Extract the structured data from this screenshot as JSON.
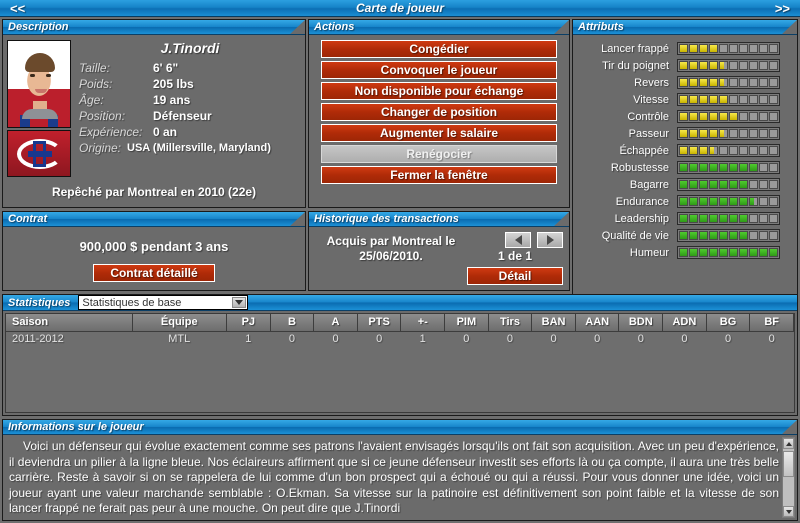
{
  "titlebar": {
    "prev": "<<",
    "title": "Carte de joueur",
    "next": ">>"
  },
  "description": {
    "header": "Description",
    "player_name": "J.Tinordi",
    "fields": [
      {
        "label": "Taille:",
        "value": "6' 6\""
      },
      {
        "label": "Poids:",
        "value": "205 lbs"
      },
      {
        "label": "Âge:",
        "value": "19 ans"
      },
      {
        "label": "Position:",
        "value": "Défenseur"
      },
      {
        "label": "Expérience:",
        "value": "0 an"
      }
    ],
    "origin_label": "Origine:",
    "origin_value": "USA (Millersville, Maryland)",
    "draft_text": "Repêché par Montreal en 2010 (22e)"
  },
  "actions": {
    "header": "Actions",
    "buttons": [
      {
        "label": "Congédier",
        "disabled": false
      },
      {
        "label": "Convoquer le joueur",
        "disabled": false
      },
      {
        "label": "Non disponible pour échange",
        "disabled": false
      },
      {
        "label": "Changer de position",
        "disabled": false
      },
      {
        "label": "Augmenter le salaire",
        "disabled": false
      },
      {
        "label": "Renégocier",
        "disabled": true
      },
      {
        "label": "Fermer la fenêtre",
        "disabled": false
      }
    ]
  },
  "attributs": {
    "header": "Attributs",
    "max": 10,
    "items": [
      {
        "name": "Lancer frappé",
        "value": 4,
        "color": "yellow"
      },
      {
        "name": "Tir du poignet",
        "value": 4.5,
        "color": "yellow"
      },
      {
        "name": "Revers",
        "value": 4.5,
        "color": "yellow"
      },
      {
        "name": "Vitesse",
        "value": 5,
        "color": "yellow"
      },
      {
        "name": "Contrôle",
        "value": 6,
        "color": "yellow"
      },
      {
        "name": "Passeur",
        "value": 4.5,
        "color": "yellow"
      },
      {
        "name": "Échappée",
        "value": 3.5,
        "color": "yellow"
      },
      {
        "name": "Robustesse",
        "value": 8,
        "color": "green"
      },
      {
        "name": "Bagarre",
        "value": 7,
        "color": "green"
      },
      {
        "name": "Endurance",
        "value": 7.5,
        "color": "green"
      },
      {
        "name": "Leadership",
        "value": 7,
        "color": "green"
      },
      {
        "name": "Qualité de vie",
        "value": 7,
        "color": "green"
      },
      {
        "name": "Humeur",
        "value": 10,
        "color": "green"
      }
    ]
  },
  "contrat": {
    "header": "Contrat",
    "amount": "900,000 $ pendant 3 ans",
    "detail_button": "Contrat détaillé"
  },
  "historique": {
    "header": "Historique des transactions",
    "text": "Acquis par Montreal le 25/06/2010.",
    "page": "1 de 1",
    "prev_icon": "left-arrow-icon",
    "next_icon": "right-arrow-icon",
    "detail_button": "Détail"
  },
  "statistiques": {
    "header": "Statistiques",
    "select_value": "Statistiques de base",
    "columns": [
      "Saison",
      "Équipe",
      "PJ",
      "B",
      "A",
      "PTS",
      "+-",
      "PIM",
      "Tirs",
      "BAN",
      "AAN",
      "BDN",
      "ADN",
      "BG",
      "BF"
    ],
    "rows": [
      [
        "2011-2012",
        "MTL",
        "1",
        "0",
        "0",
        "0",
        "1",
        "0",
        "0",
        "0",
        "0",
        "0",
        "0",
        "0",
        "0"
      ]
    ]
  },
  "informations": {
    "header": "Informations sur le joueur",
    "text": "Voici un défenseur qui évolue exactement comme ses patrons l'avaient envisagés lorsqu'ils ont fait son acquisition. Avec un peu d'expérience, il deviendra un pilier à la ligne bleue. Nos éclaireurs affirment que si ce jeune défenseur investit ses efforts là ou ça compte, il aura une très belle carrière. Reste à savoir si on se rappelera de lui comme d'un bon prospect qui a échoué ou qui a réussi.  Pour vous donner une idée, voici un joueur ayant une valeur marchande semblable : O.Ekman. Sa vitesse sur la patinoire est définitivement son point faible et la vitesse de son lancer frappé ne ferait pas peur à une mouche. On peut dire que J.Tinordi"
  },
  "colors": {
    "panel_header_blue": "#1886cb",
    "button_red": "#b02b08",
    "attr_yellow": "#f7e94a",
    "attr_green": "#4fcb2e",
    "panel_bg": "#6b6b6b"
  }
}
